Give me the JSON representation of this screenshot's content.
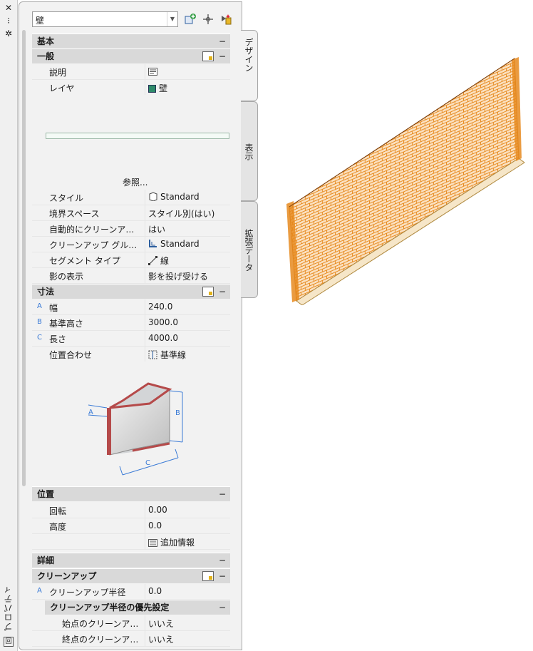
{
  "titlebar": {
    "vertical_title": "プロパティ",
    "close_glyph": "✕",
    "pin_glyph": "⁝",
    "settings_glyph": "✲",
    "bottom_glyph": "回"
  },
  "selector": {
    "value": "壁"
  },
  "tabs": [
    {
      "label": "デザイン"
    },
    {
      "label": "表示"
    },
    {
      "label": "拡張データ"
    }
  ],
  "sections": {
    "kihon": {
      "title": "基本"
    },
    "ippan": {
      "title": "一般"
    },
    "sunpo": {
      "title": "寸法"
    },
    "ichi": {
      "title": "位置"
    },
    "shosai": {
      "title": "詳細"
    },
    "cleanup": {
      "title": "クリーンアップ"
    },
    "cleanup_override": {
      "title": "クリーンアップ半径の優先設定"
    }
  },
  "minus_glyph": "−",
  "general_rows": [
    {
      "label": "説明",
      "value": ""
    },
    {
      "label": "レイヤ",
      "value": "壁"
    },
    {
      "label": "スタイル",
      "value": "Standard"
    },
    {
      "label": "境界スペース",
      "value": "スタイル別(はい)"
    },
    {
      "label": "自動的にクリーンア…",
      "value": "はい"
    },
    {
      "label": "クリーンアップ グル…",
      "value": "Standard"
    },
    {
      "label": "セグメント タイプ",
      "value": "線"
    },
    {
      "label": "影の表示",
      "value": "影を投げ受ける"
    }
  ],
  "browse_label": "参照...",
  "dimension_rows": [
    {
      "key": "A",
      "label": "幅",
      "value": "240.0"
    },
    {
      "key": "B",
      "label": "基準高さ",
      "value": "3000.0"
    },
    {
      "key": "C",
      "label": "長さ",
      "value": "4000.0"
    },
    {
      "key": "",
      "label": "位置合わせ",
      "value": "基準線"
    }
  ],
  "diagram_labels": {
    "a": "A",
    "b": "B",
    "c": "C"
  },
  "location_rows": [
    {
      "label": "回転",
      "value": "0.00"
    },
    {
      "label": "高度",
      "value": "0.0"
    },
    {
      "label": "",
      "value": "追加情報"
    }
  ],
  "cleanup_rows": [
    {
      "key": "A",
      "label": "クリーンアップ半径",
      "value": "0.0"
    }
  ],
  "override_rows": [
    {
      "label": "始点のクリーンア…",
      "value": "いいえ"
    },
    {
      "label": "終点のクリーンア…",
      "value": "いいえ"
    }
  ],
  "colors": {
    "layer_swatch": "#2e8b6a",
    "wall_brick": "#e68a1e",
    "header_bg": "#d9d9d9",
    "dim_blue": "#3b7bd6"
  }
}
